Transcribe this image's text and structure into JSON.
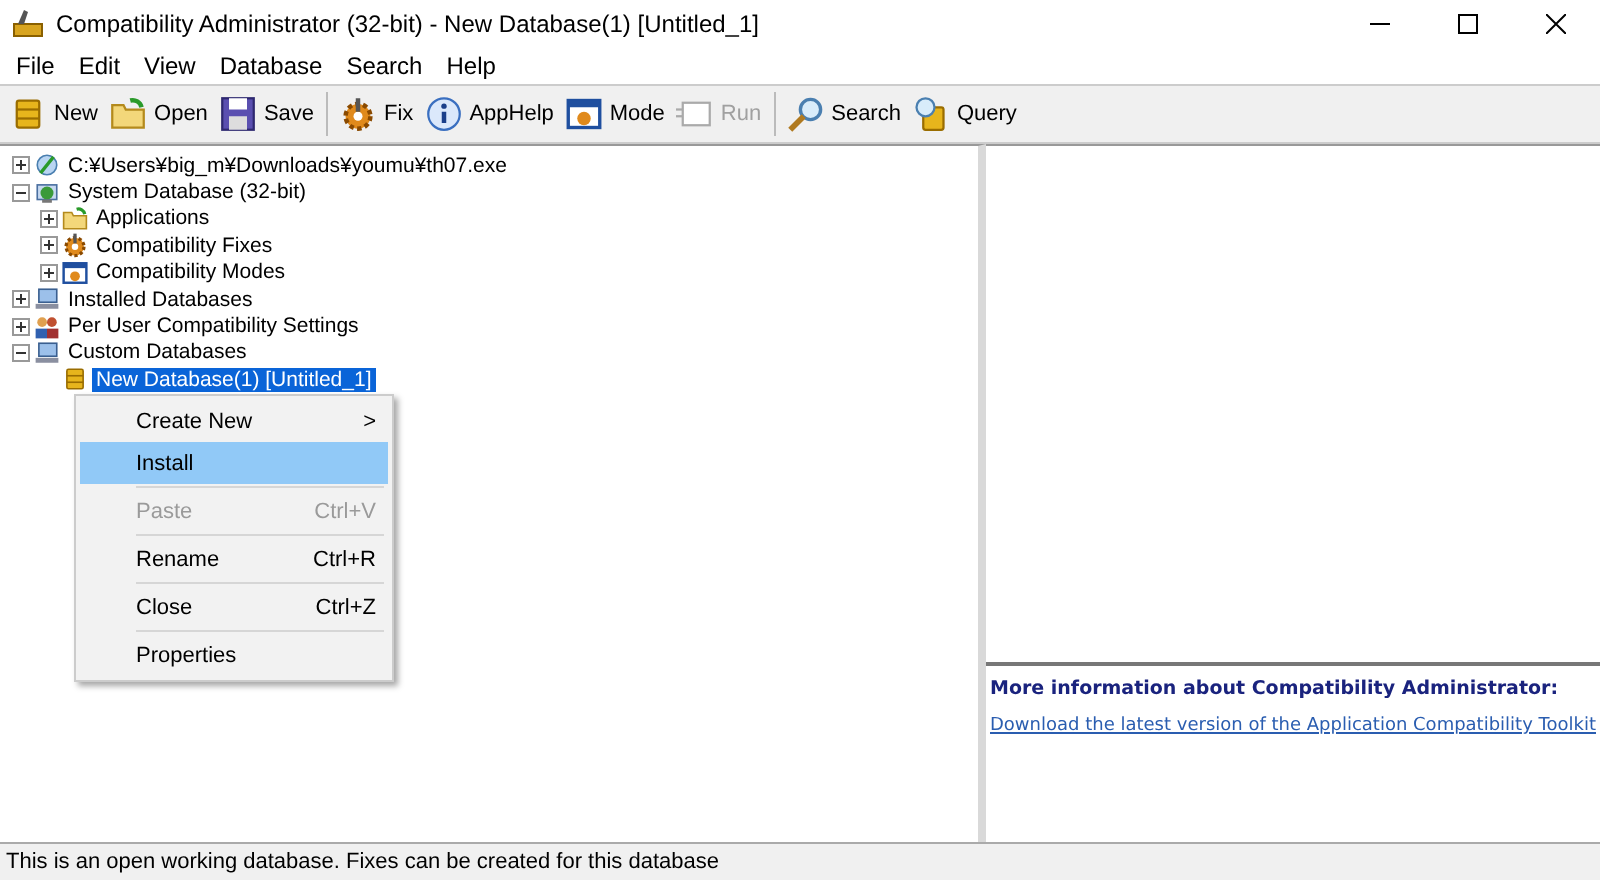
{
  "window": {
    "title": "Compatibility Administrator (32-bit) - New Database(1) [Untitled_1]"
  },
  "menu_bar": [
    "File",
    "Edit",
    "View",
    "Database",
    "Search",
    "Help"
  ],
  "toolbar": [
    {
      "kind": "button",
      "label": "New",
      "disabled": false
    },
    {
      "kind": "button",
      "label": "Open",
      "disabled": false
    },
    {
      "kind": "button",
      "label": "Save",
      "disabled": false
    },
    {
      "kind": "separator"
    },
    {
      "kind": "button",
      "label": "Fix",
      "disabled": false
    },
    {
      "kind": "button",
      "label": "AppHelp",
      "disabled": false
    },
    {
      "kind": "button",
      "label": "Mode",
      "disabled": false
    },
    {
      "kind": "button",
      "label": "Run",
      "disabled": true
    },
    {
      "kind": "separator"
    },
    {
      "kind": "button",
      "label": "Search",
      "disabled": false
    },
    {
      "kind": "button",
      "label": "Query",
      "disabled": false
    }
  ],
  "tree": [
    {
      "label": "C:¥Users¥big_m¥Downloads¥youmu¥th07.exe",
      "expanded": false,
      "selected": false
    },
    {
      "label": "System Database (32-bit)",
      "expanded": true,
      "selected": false,
      "children": [
        {
          "label": "Applications",
          "expanded": false,
          "selected": false
        },
        {
          "label": "Compatibility Fixes",
          "expanded": false,
          "selected": false
        },
        {
          "label": "Compatibility Modes",
          "expanded": false,
          "selected": false
        }
      ]
    },
    {
      "label": "Installed Databases",
      "expanded": false,
      "selected": false
    },
    {
      "label": "Per User Compatibility Settings",
      "expanded": false,
      "selected": false
    },
    {
      "label": "Custom Databases",
      "expanded": true,
      "selected": false,
      "children": [
        {
          "label": "New Database(1) [Untitled_1]",
          "selected": true
        }
      ]
    }
  ],
  "context_menu": [
    {
      "kind": "item",
      "label": "Create New",
      "submenu_mark": ">",
      "disabled": false,
      "selected": false
    },
    {
      "kind": "item",
      "label": "Install",
      "disabled": false,
      "selected": true
    },
    {
      "kind": "separator"
    },
    {
      "kind": "item",
      "label": "Paste",
      "shortcut": "Ctrl+V",
      "disabled": true,
      "selected": false
    },
    {
      "kind": "separator"
    },
    {
      "kind": "item",
      "label": "Rename",
      "shortcut": "Ctrl+R",
      "disabled": false,
      "selected": false
    },
    {
      "kind": "separator"
    },
    {
      "kind": "item",
      "label": "Close",
      "shortcut": "Ctrl+Z",
      "disabled": false,
      "selected": false
    },
    {
      "kind": "separator"
    },
    {
      "kind": "item",
      "label": "Properties",
      "disabled": false,
      "selected": false
    }
  ],
  "info_pane": {
    "heading": "More information about Compatibility Administrator:",
    "link": "Download the latest version of the Application Compatibility Toolkit"
  },
  "status_bar": "This is an open working database. Fixes can be created for this database"
}
